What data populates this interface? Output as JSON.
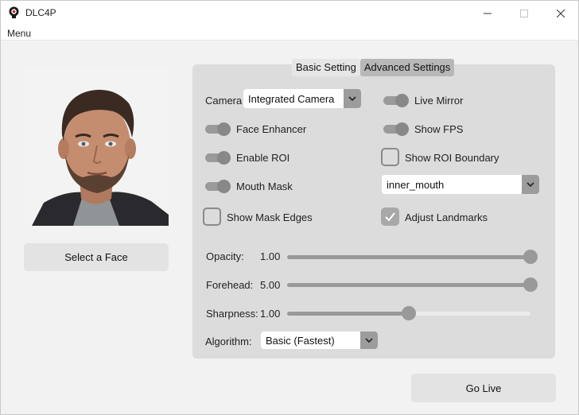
{
  "window": {
    "title": "DLC4P"
  },
  "menu": {
    "label": "Menu"
  },
  "left": {
    "select_face_label": "Select a Face"
  },
  "tabs": [
    {
      "label": "Basic Setting",
      "state": "active"
    },
    {
      "label": "Advanced Settings",
      "state": "hover"
    }
  ],
  "settings": {
    "camera_label": "Camera",
    "camera_value": "Integrated Camera",
    "live_mirror": {
      "label": "Live Mirror",
      "on": true
    },
    "face_enhancer": {
      "label": "Face Enhancer",
      "on": true
    },
    "show_fps": {
      "label": "Show FPS",
      "on": true
    },
    "enable_roi": {
      "label": "Enable ROI",
      "on": true
    },
    "show_roi_boundary": {
      "label": "Show ROI Boundary",
      "checked": false
    },
    "mouth_mask": {
      "label": "Mouth Mask",
      "on": true
    },
    "mask_mode_value": "inner_mouth",
    "show_mask_edges": {
      "label": "Show Mask Edges",
      "checked": false
    },
    "adjust_landmarks": {
      "label": "Adjust Landmarks",
      "checked": true
    },
    "opacity": {
      "label": "Opacity:",
      "value_text": "1.00",
      "fraction": 1.0
    },
    "forehead": {
      "label": "Forehead:",
      "value_text": "5.00",
      "fraction": 1.0
    },
    "sharpness": {
      "label": "Sharpness:",
      "value_text": "1.00",
      "fraction": 0.5
    },
    "algorithm_label": "Algorithm:",
    "algorithm_value": "Basic (Fastest)"
  },
  "go_live_label": "Go Live",
  "colors": {
    "panel": "#dcdcdc",
    "accent_gray": "#999999"
  }
}
